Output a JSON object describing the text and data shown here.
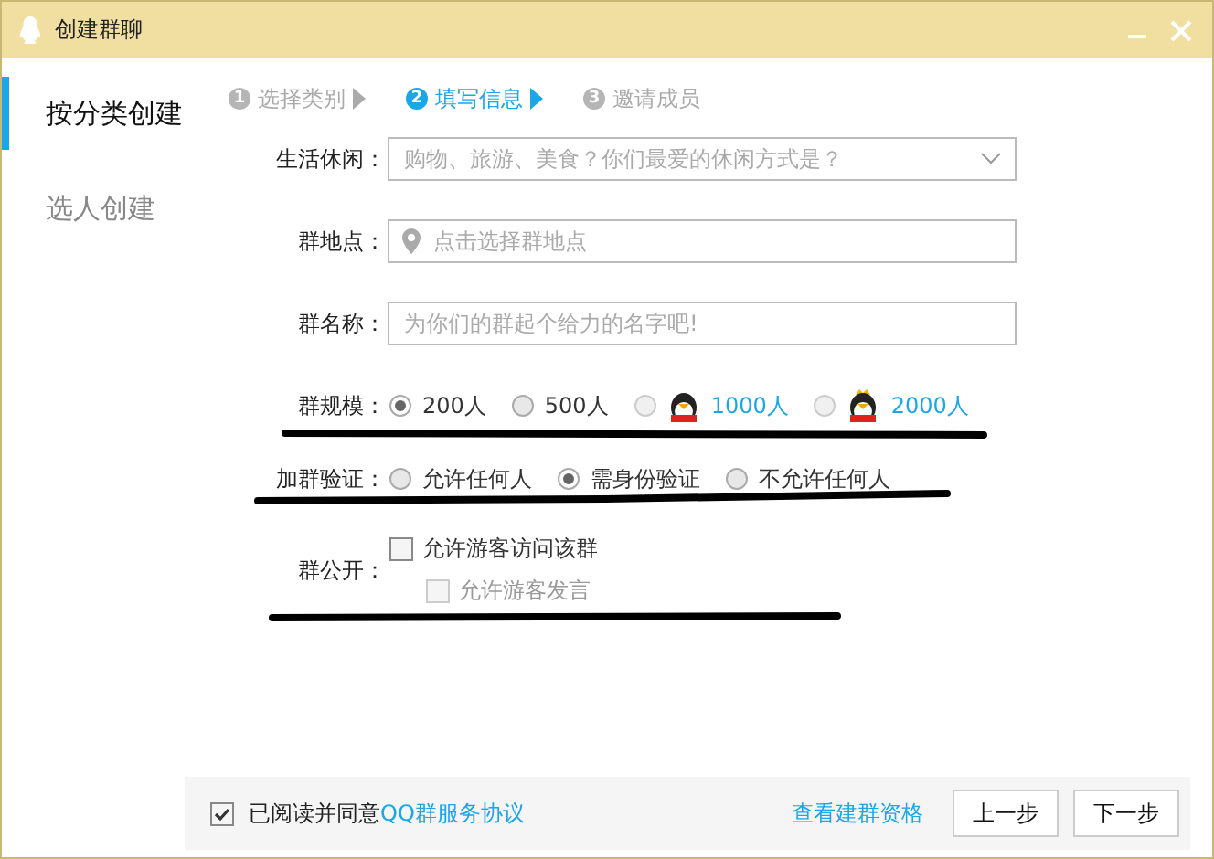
{
  "window": {
    "title": "创建群聊"
  },
  "sidebar": {
    "items": [
      {
        "label": "按分类创建",
        "selected": true
      },
      {
        "label": "选人创建",
        "selected": false
      }
    ]
  },
  "steps": [
    {
      "number": "1",
      "label": "选择类别",
      "selected": false
    },
    {
      "number": "2",
      "label": "填写信息",
      "selected": true
    },
    {
      "number": "3",
      "label": "邀请成员",
      "selected": false
    }
  ],
  "form": {
    "category": {
      "label": "生活休闲：",
      "placeholder": "购物、旅游、美食？你们最爱的休闲方式是？"
    },
    "location": {
      "label": "群地点：",
      "placeholder": "点击选择群地点"
    },
    "name": {
      "label": "群名称：",
      "placeholder": "为你们的群起个给力的名字吧!"
    },
    "size": {
      "label": "群规模：",
      "options": [
        {
          "label": "200人",
          "kind": "plain",
          "selected": true
        },
        {
          "label": "500人",
          "kind": "plain",
          "selected": false
        },
        {
          "label": "1000人",
          "kind": "vip",
          "selected": false
        },
        {
          "label": "2000人",
          "kind": "svip",
          "selected": false
        }
      ]
    },
    "verify": {
      "label": "加群验证：",
      "options": [
        {
          "label": "允许任何人",
          "selected": false
        },
        {
          "label": "需身份验证",
          "selected": true
        },
        {
          "label": "不允许任何人",
          "selected": false
        }
      ]
    },
    "public": {
      "label": "群公开：",
      "options": [
        {
          "label": "允许游客访问该群",
          "checked": false,
          "disabled": false
        },
        {
          "label": "允许游客发言",
          "checked": false,
          "disabled": true
        }
      ]
    }
  },
  "footer": {
    "agree": {
      "checked": true,
      "text": "已阅读并同意",
      "link": "QQ群服务协议"
    },
    "qualification_link": "查看建群资格",
    "buttons": [
      "上一步",
      "下一步"
    ]
  }
}
